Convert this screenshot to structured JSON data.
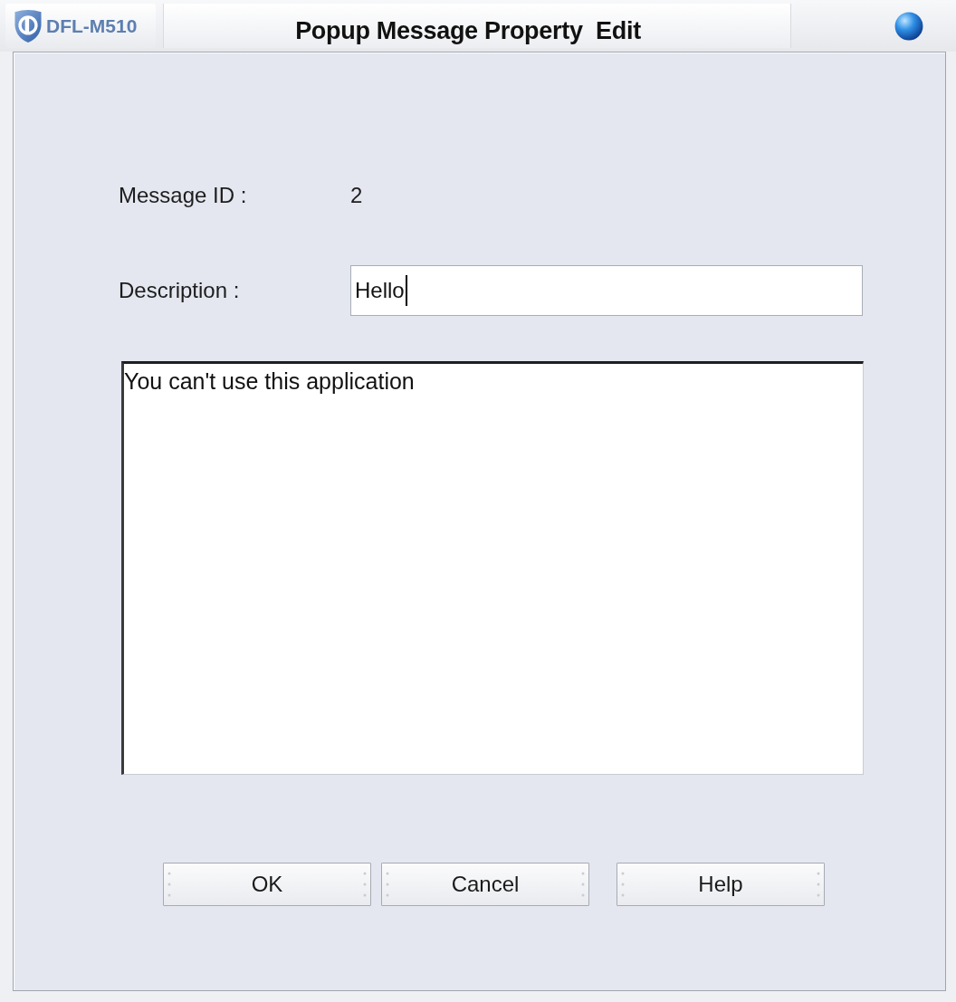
{
  "window": {
    "brand": "DFL-M510",
    "title": "Popup Message Property  Edit"
  },
  "form": {
    "message_id": {
      "label": "Message ID :",
      "value": "2"
    },
    "description": {
      "label": "Description :",
      "value": "Hello",
      "focused": true
    },
    "message": {
      "value": "You can't use this application"
    }
  },
  "buttons": [
    {
      "label": "OK"
    },
    {
      "label": "Cancel"
    },
    {
      "label": "Help"
    }
  ]
}
